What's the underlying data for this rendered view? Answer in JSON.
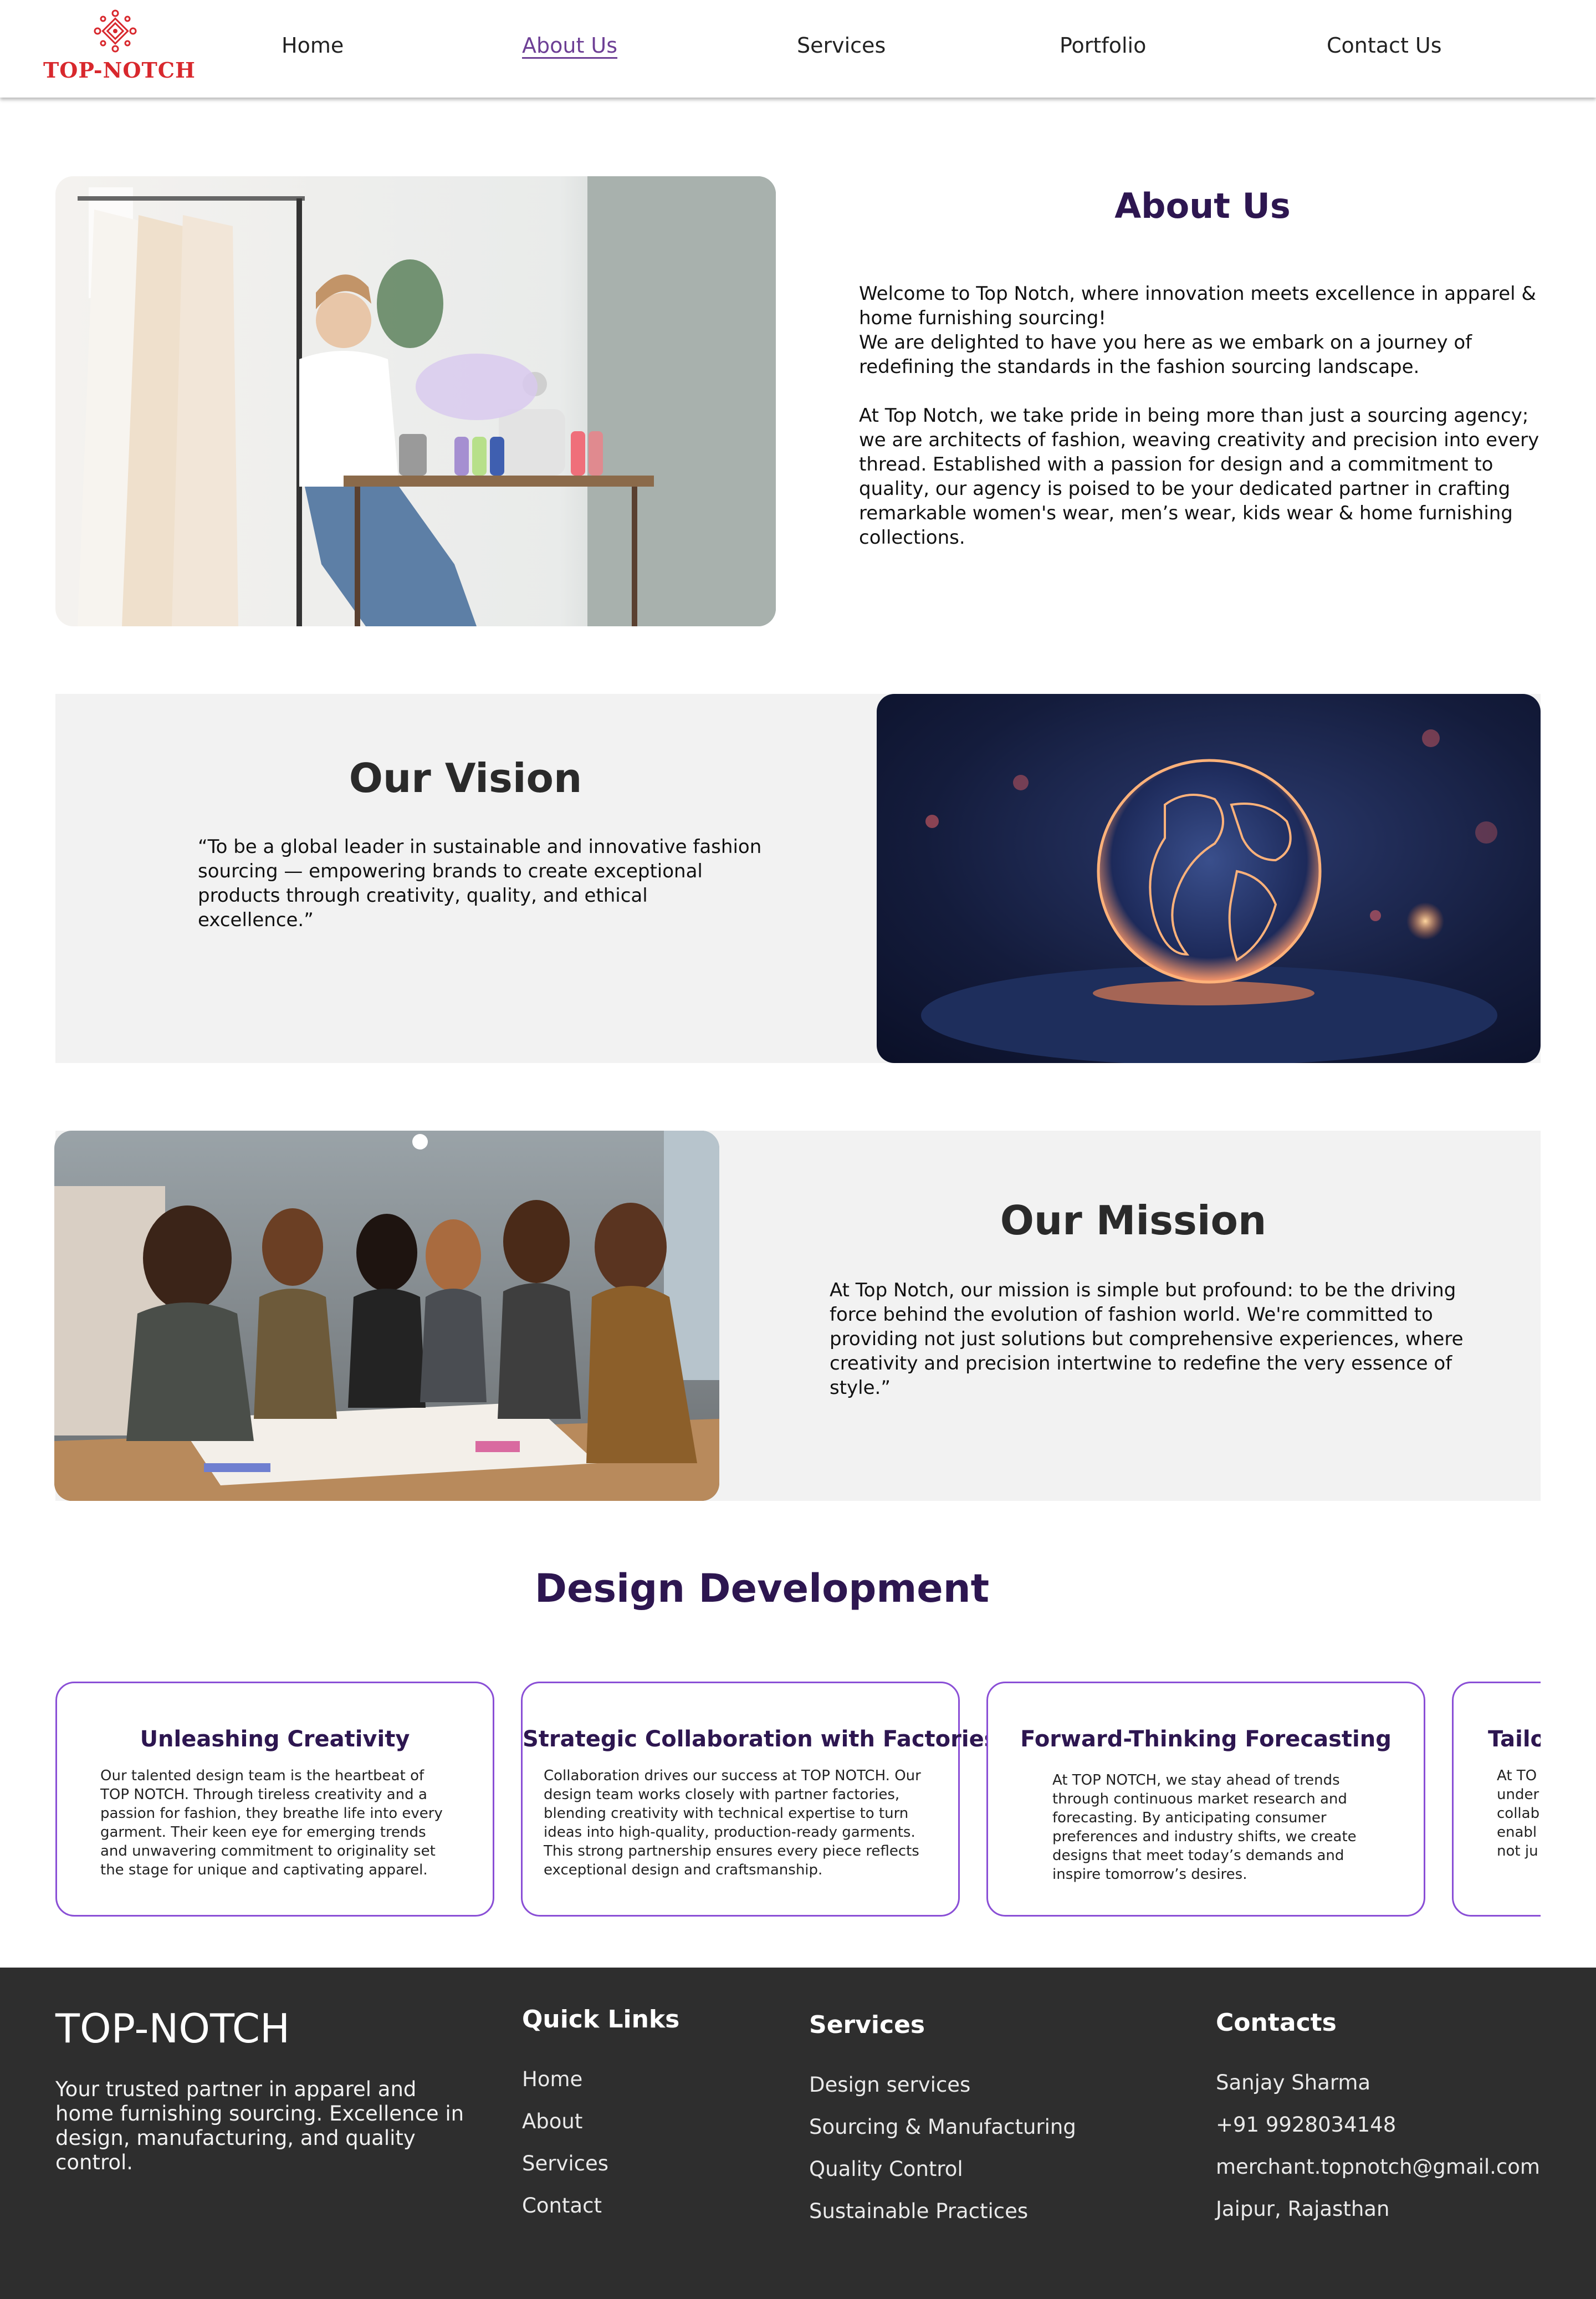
{
  "brand": {
    "name": "TOP-NOTCH",
    "logo_color": "#d8282d"
  },
  "nav": {
    "items": [
      {
        "label": "Home",
        "active": false
      },
      {
        "label": "About Us",
        "active": true
      },
      {
        "label": "Services",
        "active": false
      },
      {
        "label": "Portfolio",
        "active": false
      },
      {
        "label": "Contact Us",
        "active": false
      }
    ]
  },
  "about": {
    "title": "About Us",
    "paragraph1": "Welcome to Top Notch, where innovation meets excellence in apparel & home furnishing sourcing!\nWe are delighted to have you here as we embark on a journey of redefining the standards in the fashion sourcing landscape.",
    "paragraph2": "At Top Notch, we take pride in being more than just a sourcing agency; we are architects of fashion, weaving creativity and precision into every thread. Established with a passion for design and a commitment to quality, our agency is poised to be your dedicated partner in crafting remarkable women's wear, men’s wear, kids wear & home furnishing collections."
  },
  "vision": {
    "title": "Our Vision",
    "text": "“To be a global leader in sustainable and innovative fashion sourcing — empowering brands to create exceptional products through creativity, quality, and ethical excellence.”"
  },
  "mission": {
    "title": "Our Mission",
    "text": "At Top Notch, our mission is simple but profound: to be the driving force behind the evolution of fashion world. We're committed to providing not just solutions but comprehensive experiences, where creativity and precision intertwine to redefine the very essence of style.”"
  },
  "design_development": {
    "title": "Design Development",
    "cards": [
      {
        "title": "Unleashing Creativity",
        "body": "Our talented design team is the heartbeat of TOP NOTCH. Through tireless creativity and a passion for fashion, they breathe life into every garment. Their keen eye for emerging trends and unwavering commitment to originality set the stage for unique and captivating apparel."
      },
      {
        "title": "Strategic Collaboration with Factories",
        "body": "Collaboration drives our success at TOP NOTCH. Our design team works closely with partner factories, blending creativity with technical expertise to turn ideas into high-quality, production-ready garments. This strong partnership ensures every piece reflects exceptional design and craftsmanship."
      },
      {
        "title": "Forward-Thinking Forecasting",
        "body": "At TOP NOTCH, we stay ahead of trends through continuous market research and forecasting. By anticipating consumer preferences and industry shifts, we create designs that meet today’s demands and inspire tomorrow’s desires."
      },
      {
        "title": "Tailor",
        "body": "At TO\nunder\ncollab\nenabl\nnot ju"
      }
    ]
  },
  "footer": {
    "brand": "TOP-NOTCH",
    "tagline": "Your trusted partner in apparel and home furnishing sourcing. Excellence in design, manufacturing, and quality control.",
    "quick_links": {
      "heading": "Quick Links",
      "items": [
        "Home",
        "About",
        "Services",
        "Contact"
      ]
    },
    "services": {
      "heading": "Services",
      "items": [
        "Design services",
        "Sourcing & Manufacturing",
        "Quality Control",
        "Sustainable Practices"
      ]
    },
    "contacts": {
      "heading": "Contacts",
      "items": [
        "Sanjay Sharma",
        "+91 9928034148",
        "merchant.topnotch@gmail.com",
        "Jaipur, Rajasthan"
      ]
    }
  },
  "colors": {
    "accent_purple": "#2d1650",
    "card_border": "#8a4fd6",
    "active_nav": "#6d3f95",
    "footer_bg": "#2e2e2e",
    "section_bg": "#f2f2f2"
  }
}
